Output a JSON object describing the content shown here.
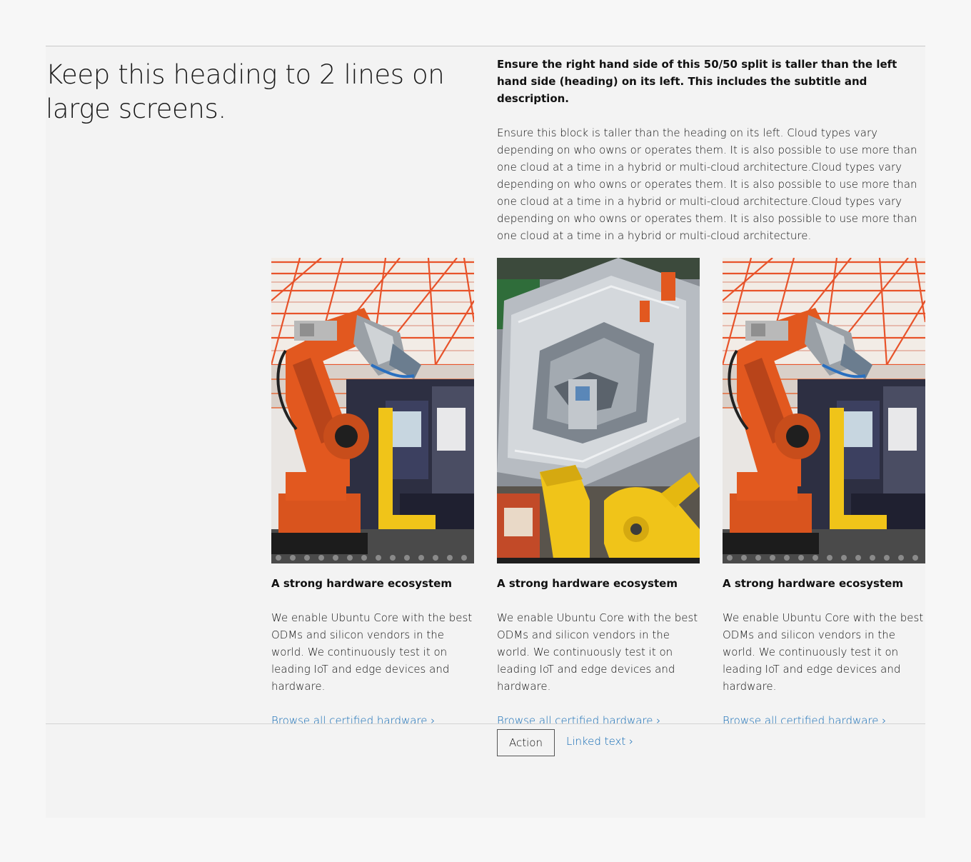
{
  "heading": "Keep this heading to 2 lines on large screens.",
  "subtitle": "Ensure the right hand side of this 50/50 split is taller than the left hand side (heading) on its left. This includes the subtitle and description.",
  "description": "Ensure this block is taller than the heading on its left. Cloud types vary depending on who owns or operates them. It is also possible to use more than one cloud at a time in a hybrid or multi-cloud architecture.Cloud types vary depending on who owns or operates them. It is also possible to use more than one cloud at a time in a hybrid or multi-cloud architecture.Cloud types vary depending on who owns or operates them. It is also possible to use more than one cloud at a time in a hybrid or multi-cloud architecture.",
  "cards": [
    {
      "image": "orange-robot-arm-factory",
      "title": "A strong hardware ecosystem",
      "body": "We enable Ubuntu Core with the best ODMs and silicon vendors in the world. We continuously test it on leading IoT and edge devices and hardware.",
      "link": "Browse all certified hardware ›"
    },
    {
      "image": "car-frame-assembly-robots",
      "title": "A strong hardware ecosystem",
      "body": "We enable Ubuntu Core with the best ODMs and silicon vendors in the world. We continuously test it on leading IoT and edge devices and hardware.",
      "link": "Browse all certified hardware ›"
    },
    {
      "image": "orange-robot-arm-factory",
      "title": "A strong hardware ecosystem",
      "body": "We enable Ubuntu Core with the best ODMs and silicon vendors in the world. We continuously test it on leading IoT and edge devices and hardware.",
      "link": "Browse all certified hardware ›"
    }
  ],
  "actions": {
    "button_label": "Action",
    "link_label": "Linked text ›"
  },
  "colors": {
    "link": "#0e68b3",
    "section_bg": "#f3f3f3",
    "page_bg": "#f7f7f7",
    "robot_orange": "#e2581f",
    "robot_yellow": "#f0c419",
    "truss_orange": "#e8532a"
  }
}
